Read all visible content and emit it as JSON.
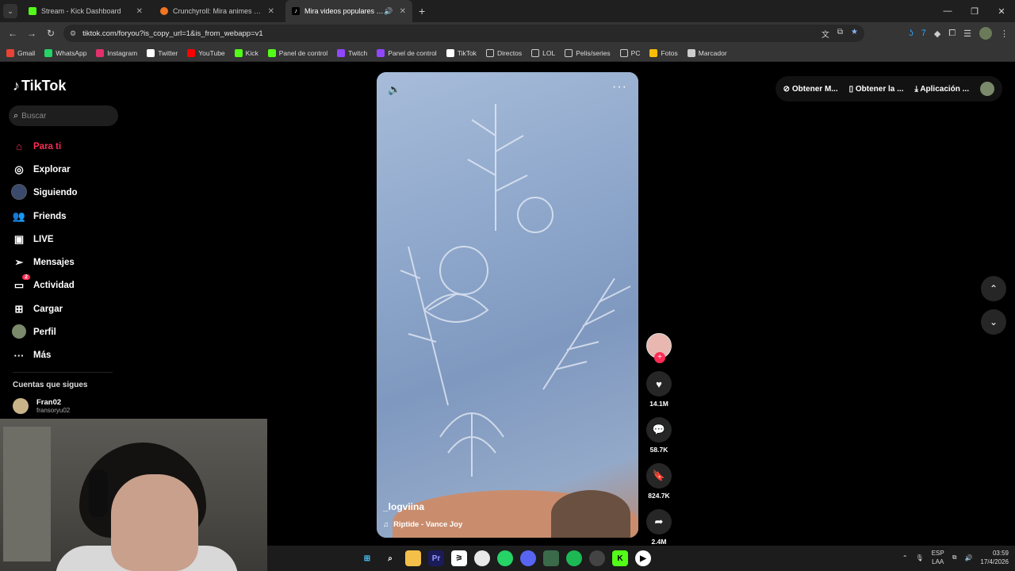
{
  "browser": {
    "tabs": [
      {
        "title": "Stream - Kick Dashboard",
        "color": "#53fc18",
        "active": false
      },
      {
        "title": "Crunchyroll: Mira animes populares",
        "color": "#f47521",
        "active": false
      },
      {
        "title": "Mira videos populares seleccionados",
        "color": "#ffffff",
        "active": true
      }
    ],
    "url": "tiktok.com/foryou?is_copy_url=1&is_from_webapp=v1",
    "bookmarks": [
      {
        "label": "Gmail",
        "color": "#ea4335"
      },
      {
        "label": "WhatsApp",
        "color": "#25d366"
      },
      {
        "label": "Instagram",
        "color": "#e1306c"
      },
      {
        "label": "Twitter",
        "color": "#ffffff"
      },
      {
        "label": "YouTube",
        "color": "#ff0000"
      },
      {
        "label": "Kick",
        "color": "#53fc18"
      },
      {
        "label": "Panel de control",
        "color": "#53fc18"
      },
      {
        "label": "Twitch",
        "color": "#9146ff"
      },
      {
        "label": "Panel de control",
        "color": "#9146ff"
      },
      {
        "label": "TikTok",
        "color": "#ffffff"
      },
      {
        "label": "Directos",
        "color": "folder"
      },
      {
        "label": "LOL",
        "color": "folder"
      },
      {
        "label": "Pelis/series",
        "color": "folder"
      },
      {
        "label": "PC",
        "color": "folder"
      },
      {
        "label": "Fotos",
        "color": "#fbbc04"
      },
      {
        "label": "Marcador",
        "color": "#cccccc"
      }
    ]
  },
  "tiktok": {
    "logo": "TikTok",
    "search_placeholder": "Buscar",
    "nav": [
      {
        "label": "Para ti",
        "icon": "home-icon",
        "active": true
      },
      {
        "label": "Explorar",
        "icon": "compass-icon"
      },
      {
        "label": "Siguiendo",
        "icon": "following-avatar"
      },
      {
        "label": "Friends",
        "icon": "friends-icon"
      },
      {
        "label": "LIVE",
        "icon": "live-icon"
      },
      {
        "label": "Mensajes",
        "icon": "send-icon"
      },
      {
        "label": "Actividad",
        "icon": "activity-icon",
        "badge": "2"
      },
      {
        "label": "Cargar",
        "icon": "upload-icon"
      },
      {
        "label": "Perfil",
        "icon": "profile-avatar"
      },
      {
        "label": "Más",
        "icon": "more-icon"
      }
    ],
    "following_header": "Cuentas que sigues",
    "following": [
      {
        "name": "Fran02",
        "handle": "fransoryu02"
      }
    ],
    "top_right": [
      "Obtener M...",
      "Obtener la ...",
      "Aplicación ..."
    ],
    "video": {
      "username": "_logviina",
      "music": "Riptide - Vance Joy"
    },
    "actions": {
      "likes": "14.1M",
      "comments": "58.7K",
      "saves": "824.7K",
      "shares": "2.4M"
    }
  },
  "taskbar": {
    "lang_line1": "ESP",
    "lang_line2": "LAA",
    "time": "03:59",
    "date": "17/4/2026"
  }
}
